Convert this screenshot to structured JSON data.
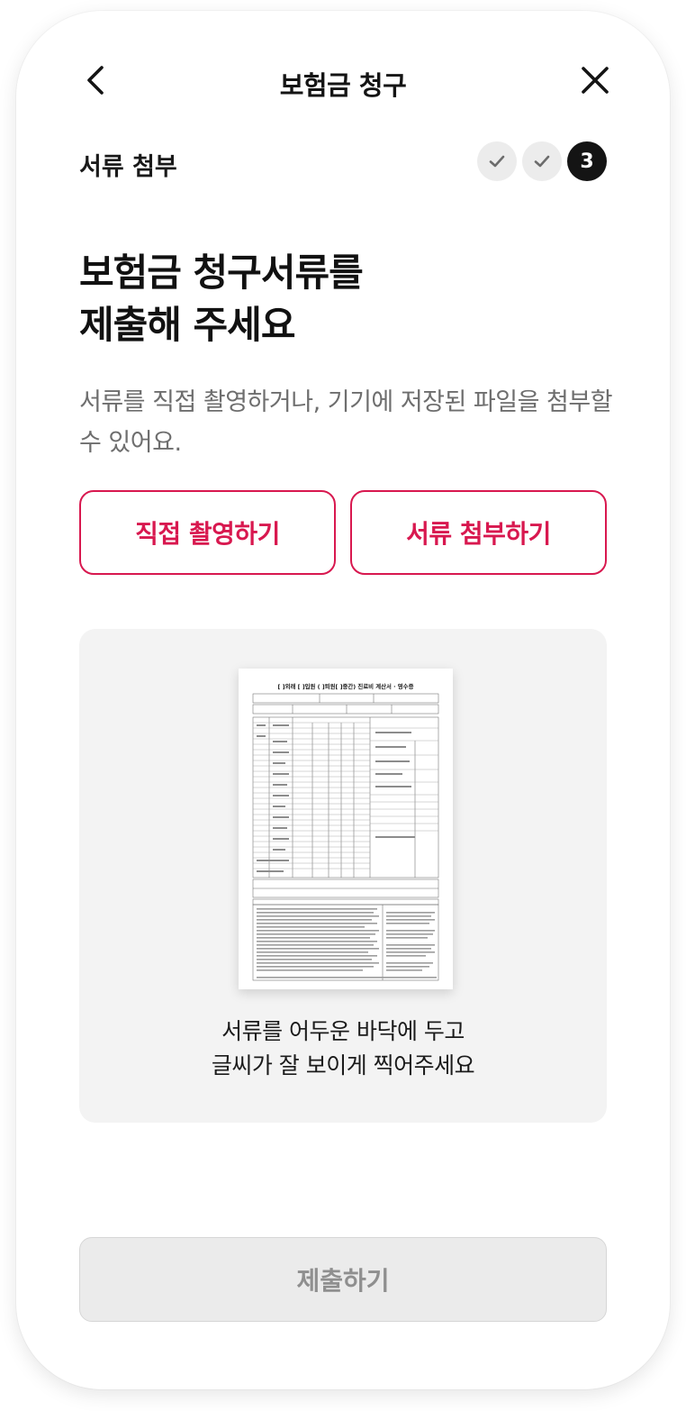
{
  "header": {
    "title": "보험금 청구",
    "back_icon": "chevron-left-icon",
    "close_icon": "close-icon"
  },
  "step": {
    "label": "서류 첨부",
    "steps": [
      {
        "state": "done",
        "icon": "check-icon"
      },
      {
        "state": "done",
        "icon": "check-icon"
      },
      {
        "state": "current",
        "number": "3"
      }
    ]
  },
  "main": {
    "headline_line1": "보험금 청구서류를",
    "headline_line2": "제출해 주세요",
    "description": "서류를 직접 촬영하거나, 기기에 저장된 파일을 첨부할 수 있어요."
  },
  "actions": {
    "camera_label": "직접 촬영하기",
    "attach_label": "서류 첨부하기"
  },
  "guide": {
    "document_image": "document-sample-image",
    "doc_title": "[ ]외래 [ ]입원 ( ]퇴원[ ]중간) 진료비 계산서 · 영수증",
    "line1": "서류를 어두운 바닥에 두고",
    "line2": "글씨가 잘 보이게 찍어주세요"
  },
  "footer": {
    "submit_label": "제출하기"
  },
  "colors": {
    "accent": "#d8184f",
    "disabled_bg": "#ebebeb",
    "card_bg": "#f3f3f3"
  }
}
